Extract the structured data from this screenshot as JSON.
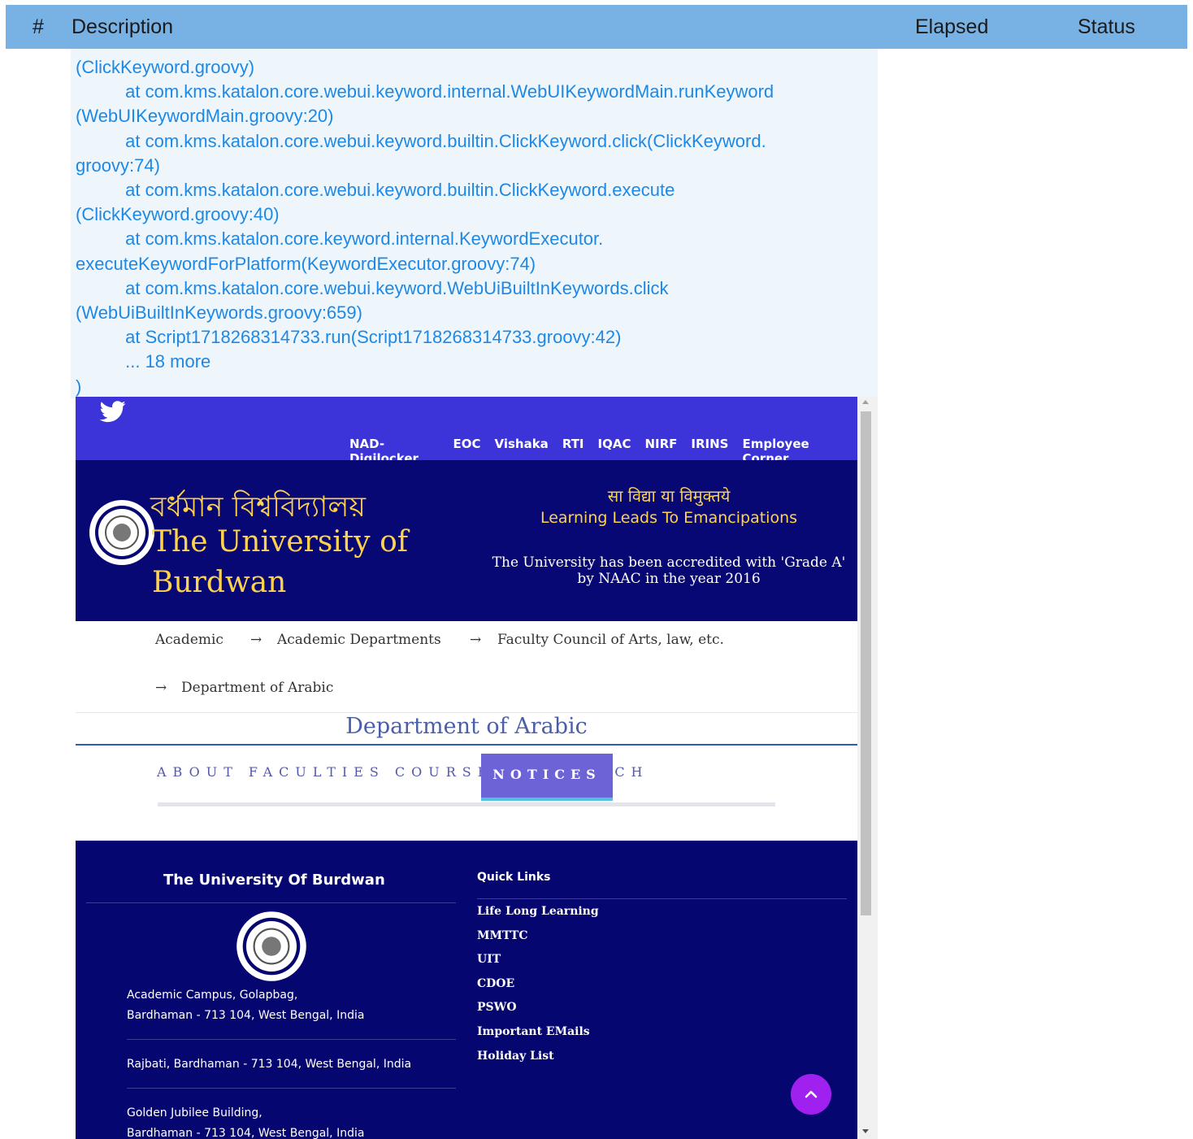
{
  "report": {
    "columns": {
      "index": "#",
      "description": "Description",
      "elapsed": "Elapsed",
      "status": "Status"
    },
    "log_lines": [
      "(ClickKeyword.groovy)",
      "\tat com.kms.katalon.core.webui.keyword.internal.WebUIKeywordMain.runKeyword",
      "(WebUIKeywordMain.groovy:20)",
      "\tat com.kms.katalon.core.webui.keyword.builtin.ClickKeyword.click(ClickKeyword.",
      "groovy:74)",
      "\tat com.kms.katalon.core.webui.keyword.builtin.ClickKeyword.execute",
      "(ClickKeyword.groovy:40)",
      "\tat com.kms.katalon.core.keyword.internal.KeywordExecutor.",
      "executeKeywordForPlatform(KeywordExecutor.groovy:74)",
      "\tat com.kms.katalon.core.webui.keyword.WebUiBuiltInKeywords.click",
      "(WebUiBuiltInKeywords.groovy:659)",
      "\tat Script1718268314733.run(Script1718268314733.groovy:42)",
      "\t... 18 more",
      ")"
    ]
  },
  "site": {
    "top_links": [
      "NAD-Digilocker",
      "EOC",
      "Vishaka",
      "RTI",
      "IQAC",
      "NIRF",
      "IRINS",
      "Employee Corner"
    ],
    "bengali_title": "বর্ধমান বিশ্ববিদ্যালয়",
    "english_title": "The University of Burdwan",
    "motto_hindi": "सा विद्या या विमुक्तये",
    "motto_english": "Learning Leads To Emancipations",
    "accreditation": "The University has been accredited with 'Grade A' by NAAC in the year 2016",
    "breadcrumb": [
      "Academic",
      "Academic Departments",
      "Faculty Council of Arts, law, etc.",
      "Department of Arabic"
    ],
    "breadcrumb_arrow": "→",
    "department_title": "Department of Arabic",
    "tabs": [
      "ABOUT",
      "FACULTIES",
      "COURSES",
      "RESEARCH"
    ],
    "active_tab": "NOTICES",
    "footer": {
      "university": "The University Of Burdwan",
      "addresses": [
        "Academic Campus, Golapbag,\nBardhaman - 713 104, West Bengal, India",
        "Rajbati, Bardhaman - 713 104, West Bengal, India",
        "Golden Jubilee Building,\nBardhaman - 713 104, West Bengal, India"
      ],
      "quick_links_title": "Quick Links",
      "quick_links": [
        "Life Long Learning",
        "MMTTC",
        "UIT",
        "CDOE",
        "PSWO",
        "Important EMails",
        "Holiday List"
      ]
    },
    "icons": {
      "social": "twitter-icon",
      "back_to_top": "chevron-up-icon",
      "seal": "university-seal-icon"
    },
    "colors": {
      "topbar": "#3c34d8",
      "banner": "#080874",
      "title_gold": "#ffd24d",
      "footer": "#060670",
      "active_tab": "#6c63d6",
      "scroll_button": "#a020f0",
      "report_header": "#78b1e4",
      "log_text": "#1e88e5"
    }
  }
}
